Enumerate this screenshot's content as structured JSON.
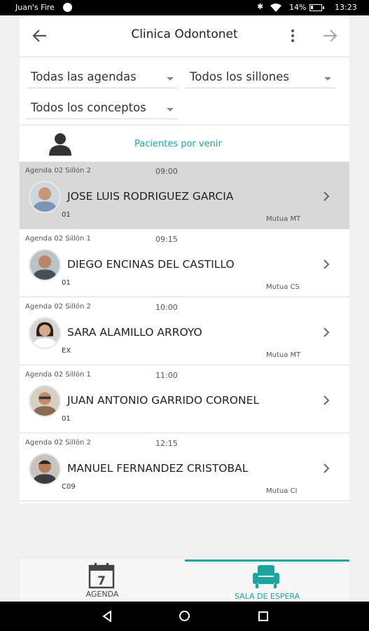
{
  "status_bar": {
    "carrier": "Juan's Fire",
    "battery": "14%",
    "time": "13:23"
  },
  "appbar": {
    "title": "Clinica Odontonet",
    "icons": [
      "back-arrow-icon",
      "more-vert-icon",
      "forward-arrow-icon"
    ]
  },
  "filters": {
    "agendas": "Todas las agendas",
    "sillones": "Todos los sillones",
    "conceptos": "Todos los conceptos"
  },
  "section": {
    "caption": "Pacientes por venir",
    "accent_color": "#1aa5a0"
  },
  "patients": [
    {
      "agenda": "Agenda 02 Sillón 2",
      "time": "09:00",
      "name": "JOSE LUIS RODRIGUEZ GARCIA",
      "code": "01",
      "insurer": "Mutua MT",
      "selected": true
    },
    {
      "agenda": "Agenda 02 Sillón 1",
      "time": "09:15",
      "name": "DIEGO ENCINAS DEL CASTILLO",
      "code": "01",
      "insurer": "Mutua CS",
      "selected": false
    },
    {
      "agenda": "Agenda 02 Sillón 2",
      "time": "10:00",
      "name": "SARA ALAMILLO ARROYO",
      "code": "EX",
      "insurer": "Mutua MT",
      "selected": false
    },
    {
      "agenda": "Agenda 02 Sillón 1",
      "time": "11:00",
      "name": "JUAN ANTONIO GARRIDO CORONEL",
      "code": "01",
      "insurer": "",
      "selected": false
    },
    {
      "agenda": "Agenda 02 Sillón 2",
      "time": "12:15",
      "name": "MANUEL FERNANDEZ CRISTOBAL",
      "code": "C09",
      "insurer": "Mutua CI",
      "selected": false
    }
  ],
  "bottom_nav": {
    "agenda_label": "AGENDA",
    "calendar_day": "7",
    "sala_label": "SALA DE ESPERA",
    "active": "sala"
  }
}
